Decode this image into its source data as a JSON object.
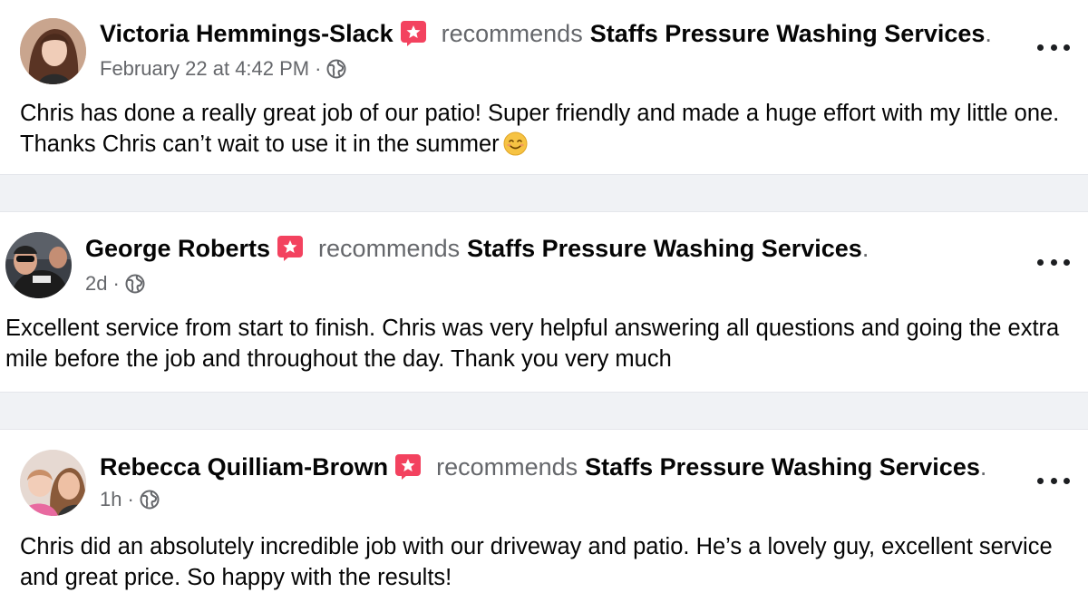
{
  "posts": [
    {
      "author": "Victoria Hemmings-Slack",
      "verb": "recommends",
      "page": "Staffs Pressure Washing Services",
      "period": ".",
      "time": "February 22 at 4:42 PM",
      "privacy_icon": "globe-icon",
      "body": "Chris has done a really great job of our patio! Super friendly and made a huge effort with my little one. Thanks Chris can’t wait to use it in the summer",
      "emoji": "smiling-face-icon"
    },
    {
      "author": "George Roberts",
      "verb": "recommends",
      "page": "Staffs Pressure Washing Services",
      "period": ".",
      "time": "2d",
      "privacy_icon": "globe-icon",
      "body": "Excellent service from start to finish. Chris was very helpful answering all questions and going the extra mile before the job and throughout the day. Thank you very much"
    },
    {
      "author": "Rebecca Quilliam-Brown",
      "verb": "recommends",
      "page": "Staffs Pressure Washing Services",
      "period": ".",
      "time": "1h",
      "privacy_icon": "globe-icon",
      "body": "Chris did an absolutely incredible job with our driveway and patio. He’s a lovely guy, excellent service and great price. So happy with the results!"
    }
  ],
  "separator_dot": "·",
  "colors": {
    "recommend_badge": "#f3425f",
    "secondary_text": "#65676b",
    "primary_text": "#050505",
    "divider_bg": "#f0f2f5"
  }
}
